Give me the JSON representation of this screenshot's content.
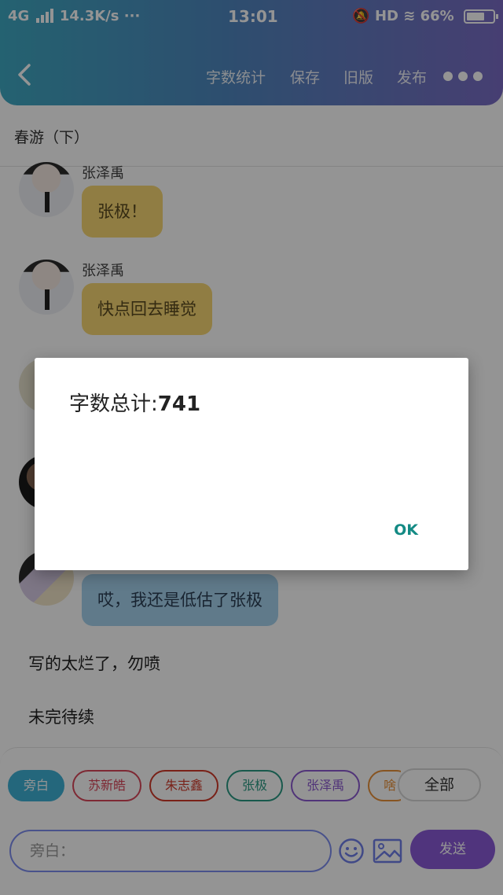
{
  "status_bar": {
    "network": "4G",
    "speed": "14.3K/s ···",
    "time": "13:01",
    "right": "HD",
    "battery": "66%"
  },
  "navbar": {
    "back": "‹",
    "items": [
      "字数统计",
      "保存",
      "旧版",
      "发布"
    ]
  },
  "doc_title": "春游（下）",
  "messages": [
    {
      "speaker": "张泽禹",
      "text": "张极！",
      "color": "#f8d874"
    },
    {
      "speaker": "张泽禹",
      "text": "快点回去睡觉",
      "color": "#f8d874"
    },
    {
      "speaker": "",
      "text": "哎，我还是低估了张极",
      "color": "#a5d3ee"
    }
  ],
  "narrations": [
    "写的太烂了，勿喷",
    "未完待续"
  ],
  "chips": [
    {
      "label": "旁白",
      "color": "#3fb1d6",
      "active": true
    },
    {
      "label": "苏新皓",
      "color": "#d9475b"
    },
    {
      "label": "朱志鑫",
      "color": "#d03a2a"
    },
    {
      "label": "张极",
      "color": "#2a9a84"
    },
    {
      "label": "张泽禹",
      "color": "#8c5ad0"
    },
    {
      "label": "啥",
      "color": "#e8913a"
    }
  ],
  "all_button": "全部",
  "input_placeholder": "旁白：",
  "send_button": "发送",
  "dialog": {
    "label": "字数总计:",
    "count": "741",
    "ok": "OK"
  }
}
